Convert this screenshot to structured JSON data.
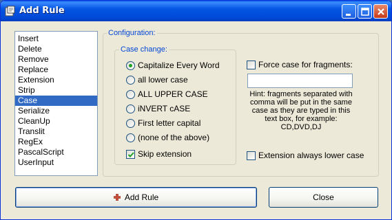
{
  "window": {
    "title": "Add Rule"
  },
  "rules_list": {
    "items": [
      "Insert",
      "Delete",
      "Remove",
      "Replace",
      "Extension",
      "Strip",
      "Case",
      "Serialize",
      "CleanUp",
      "Translit",
      "RegEx",
      "PascalScript",
      "UserInput"
    ],
    "selected_index": 6
  },
  "config": {
    "group_label": "Configuration:",
    "case_group_label": "Case change:",
    "options": [
      {
        "label": "Capitalize Every Word",
        "checked": true
      },
      {
        "label": "all lower case",
        "checked": false
      },
      {
        "label": "ALL UPPER CASE",
        "checked": false
      },
      {
        "label": "iNVERT cASE",
        "checked": false
      },
      {
        "label": "First letter capital",
        "checked": false
      },
      {
        "label": "(none of the above)",
        "checked": false
      }
    ],
    "skip_extension": {
      "label": "Skip extension",
      "checked": true
    },
    "force_case": {
      "label": "Force case for fragments:",
      "checked": false,
      "value": ""
    },
    "hint_lines": [
      "Hint: fragments separated with",
      "comma will be put in the same",
      "case as they are typed in this",
      "text box, for example:",
      "CD,DVD,DJ"
    ],
    "ext_lower": {
      "label": "Extension always lower case",
      "checked": false
    }
  },
  "buttons": {
    "add_rule": "Add Rule",
    "close": "Close"
  },
  "colors": {
    "title_bar": "#0553e0",
    "selection": "#316ac5",
    "group_label": "#0046d5",
    "radio_dot": "#21a121"
  }
}
